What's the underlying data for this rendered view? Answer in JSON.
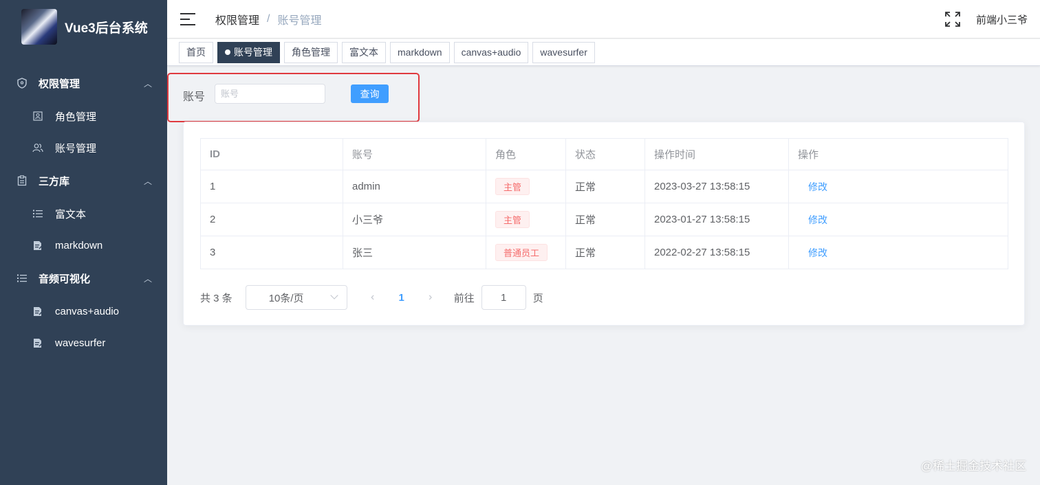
{
  "brand": {
    "title": "Vue3后台系统"
  },
  "sidebar": {
    "groups": [
      {
        "label": "权限管理",
        "icon": "shield-icon",
        "items": [
          {
            "label": "角色管理",
            "icon": "role-icon"
          },
          {
            "label": "账号管理",
            "icon": "users-icon"
          }
        ]
      },
      {
        "label": "三方库",
        "icon": "clipboard-icon",
        "items": [
          {
            "label": "富文本",
            "icon": "list-icon"
          },
          {
            "label": "markdown",
            "icon": "document-icon"
          }
        ]
      },
      {
        "label": "音频可视化",
        "icon": "list-icon",
        "items": [
          {
            "label": "canvas+audio",
            "icon": "document-icon"
          },
          {
            "label": "wavesurfer",
            "icon": "document-icon"
          }
        ]
      }
    ]
  },
  "header": {
    "breadcrumb": [
      "权限管理",
      "账号管理"
    ],
    "breadcrumb_separator": "/",
    "username": "前端小三爷"
  },
  "tags": [
    "首页",
    "账号管理",
    "角色管理",
    "富文本",
    "markdown",
    "canvas+audio",
    "wavesurfer"
  ],
  "search": {
    "label": "账号",
    "placeholder": "账号",
    "button": "查询"
  },
  "table": {
    "columns": [
      "ID",
      "账号",
      "角色",
      "状态",
      "操作时间",
      "操作"
    ],
    "rows": [
      {
        "id": "1",
        "account": "admin",
        "role": "主管",
        "status": "正常",
        "time": "2023-03-27 13:58:15",
        "action": "修改"
      },
      {
        "id": "2",
        "account": "小三爷",
        "role": "主管",
        "status": "正常",
        "time": "2023-01-27 13:58:15",
        "action": "修改"
      },
      {
        "id": "3",
        "account": "张三",
        "role": "普通员工",
        "status": "正常",
        "time": "2022-02-27 13:58:15",
        "action": "修改"
      }
    ]
  },
  "pagination": {
    "total": "共 3 条",
    "page_size": "10条/页",
    "prev": "‹",
    "current": "1",
    "next": "›",
    "goto_label": "前往",
    "goto_value": "1",
    "goto_suffix": "页"
  },
  "watermark": "@稀土掘金技术社区",
  "colors": {
    "sidebar_bg": "#304156",
    "accent": "#409eff",
    "danger": "#f56c6c",
    "highlight_box": "#e0393e"
  }
}
